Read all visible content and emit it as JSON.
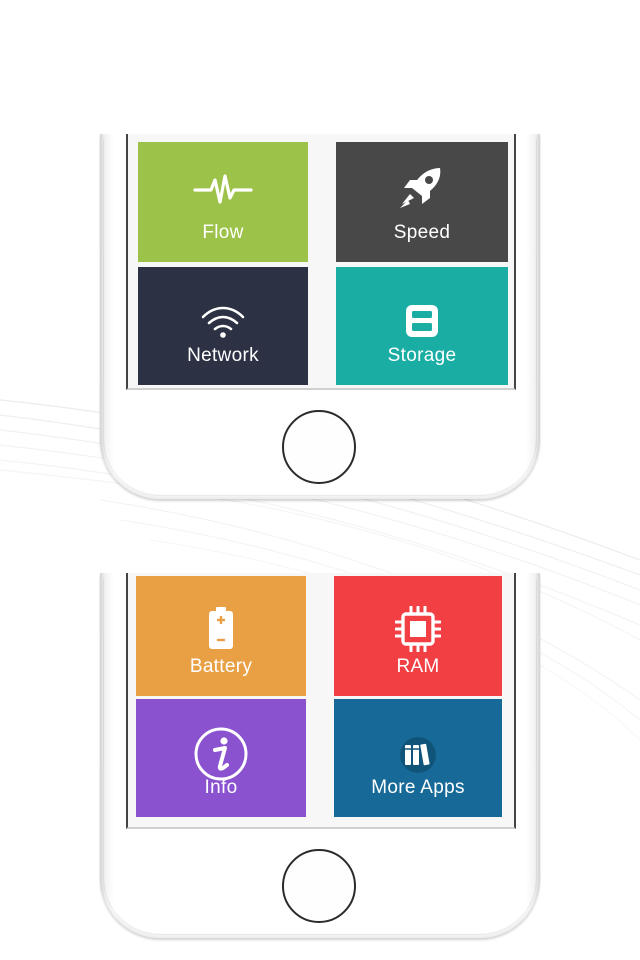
{
  "colors": {
    "flow": "#9dc24a",
    "speed": "#484848",
    "network": "#2c3244",
    "storage": "#1aada4",
    "battery": "#e9a044",
    "ram": "#f23f44",
    "info": "#8a52cf",
    "more_apps": "#176a98"
  },
  "top_phone": {
    "tiles": [
      {
        "label": "Flow",
        "icon": "pulse-icon"
      },
      {
        "label": "Speed",
        "icon": "rocket-icon"
      },
      {
        "label": "Network",
        "icon": "wifi-icon"
      },
      {
        "label": "Storage",
        "icon": "floppy-disk-icon"
      }
    ]
  },
  "bottom_phone": {
    "tiles": [
      {
        "label": "Battery",
        "icon": "battery-icon"
      },
      {
        "label": "RAM",
        "icon": "chip-icon"
      },
      {
        "label": "Info",
        "icon": "info-icon"
      },
      {
        "label": "More Apps",
        "icon": "books-icon"
      }
    ]
  }
}
